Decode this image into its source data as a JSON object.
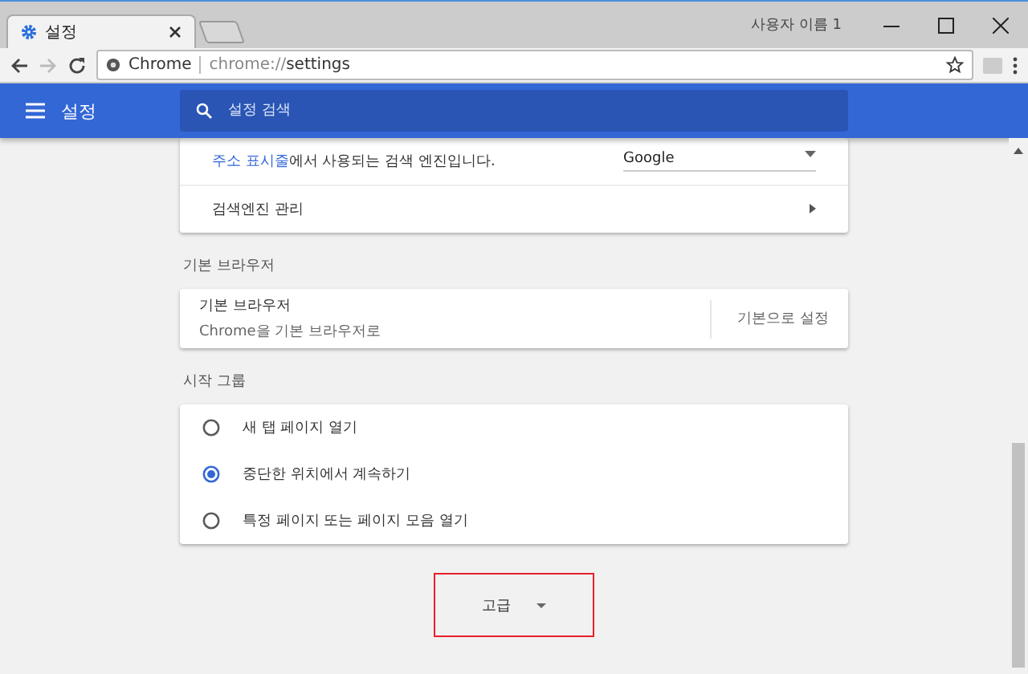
{
  "window": {
    "tab_title": "설정",
    "profile": "사용자 이름 1"
  },
  "toolbar": {
    "site_label": "Chrome",
    "url_scheme": "chrome://",
    "url_path": "settings"
  },
  "header": {
    "title": "설정",
    "search": {
      "placeholder": "설정 검색"
    }
  },
  "search_engine": {
    "rows": [
      {
        "kind": "select",
        "link_text": "주소 표시줄",
        "label": "에서 사용되는 검색 엔진입니다.",
        "value": "Google"
      },
      {
        "kind": "link",
        "label": "검색엔진 관리"
      }
    ]
  },
  "default_browser": {
    "heading": "기본 브라우저",
    "title": "기본 브라우저",
    "subtitle": "Chrome을 기본 브라우저로",
    "button": "기본으로 설정"
  },
  "startup": {
    "heading": "시작 그룹",
    "options": [
      {
        "label": "새 탭 페이지 열기",
        "selected": false
      },
      {
        "label": "중단한 위치에서 계속하기",
        "selected": true
      },
      {
        "label": "특정 페이지 또는 페이지 모음 열기",
        "selected": false
      }
    ]
  },
  "advanced": {
    "label": "고급",
    "highlighted": true
  }
}
